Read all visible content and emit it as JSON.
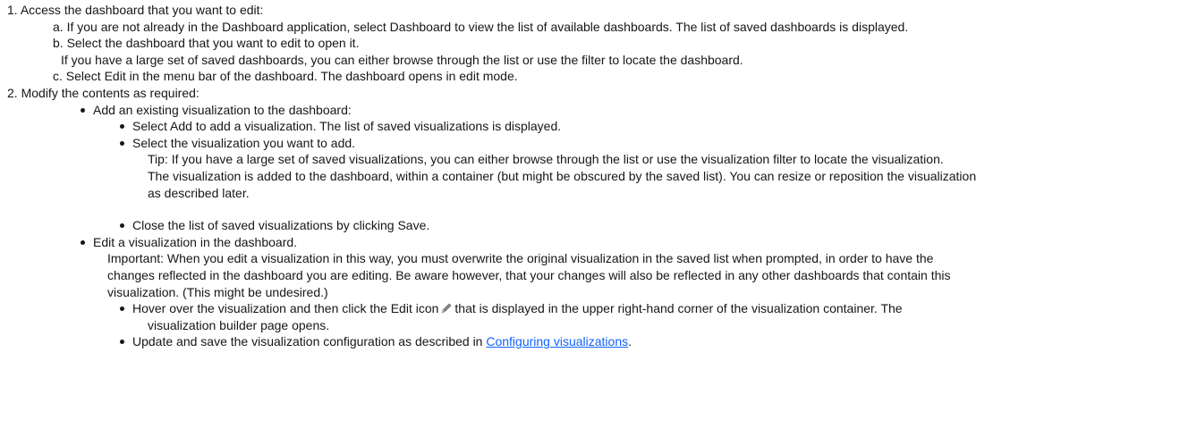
{
  "steps": [
    {
      "num": "1.",
      "text": "Access the dashboard that you want to edit:",
      "substeps": [
        {
          "marker": "a.",
          "text": "If you are not already in the Dashboard application, select Dashboard to view the list of available dashboards. The list of saved dashboards is displayed."
        },
        {
          "marker": "b.",
          "text": "Select the dashboard that you want to edit to open it.",
          "note": "If you have a large set of saved dashboards, you can either browse through the list or use the filter to locate the dashboard."
        },
        {
          "marker": "c.",
          "text": "Select Edit in the menu bar of the dashboard. The dashboard opens in edit mode."
        }
      ]
    },
    {
      "num": "2.",
      "text": "Modify the contents as required:"
    }
  ],
  "add_vis": {
    "text": "Add an existing visualization to the dashboard:",
    "items": [
      "Select Add to add a visualization. The list of saved visualizations is displayed.",
      "Select the visualization you want to add."
    ],
    "tip": "Tip: If you have a large set of saved visualizations, you can either browse through the list or use the visualization filter to locate the visualization.",
    "added_line1": "The visualization is added to the dashboard, within a container (but might be obscured by the saved list). You can resize or reposition the visualization",
    "added_line2": "as described later.",
    "close": "Close the list of saved visualizations by clicking Save."
  },
  "edit_vis": {
    "text": "Edit a visualization in the dashboard.",
    "important_line1": "Important: When you edit a visualization in this way, you must overwrite the original visualization in the saved list when prompted, in order to have the",
    "important_line2": "changes reflected in the dashboard you are editing. Be aware however, that your changes will also be reflected in any other dashboards that contain this",
    "important_line3": "visualization. (This might be undesired.)",
    "hover_pre": "Hover over the visualization and then click the Edit icon",
    "hover_post": "that is displayed in the upper right-hand corner of the visualization container. The",
    "hover_line2": "visualization builder page opens.",
    "update_pre": "Update and save the visualization configuration as described in",
    "update_link": "Configuring visualizations",
    "update_post": "."
  },
  "icons": {
    "edit": "pencil-icon"
  },
  "colors": {
    "link": "#0f62fe",
    "text": "#161616"
  }
}
